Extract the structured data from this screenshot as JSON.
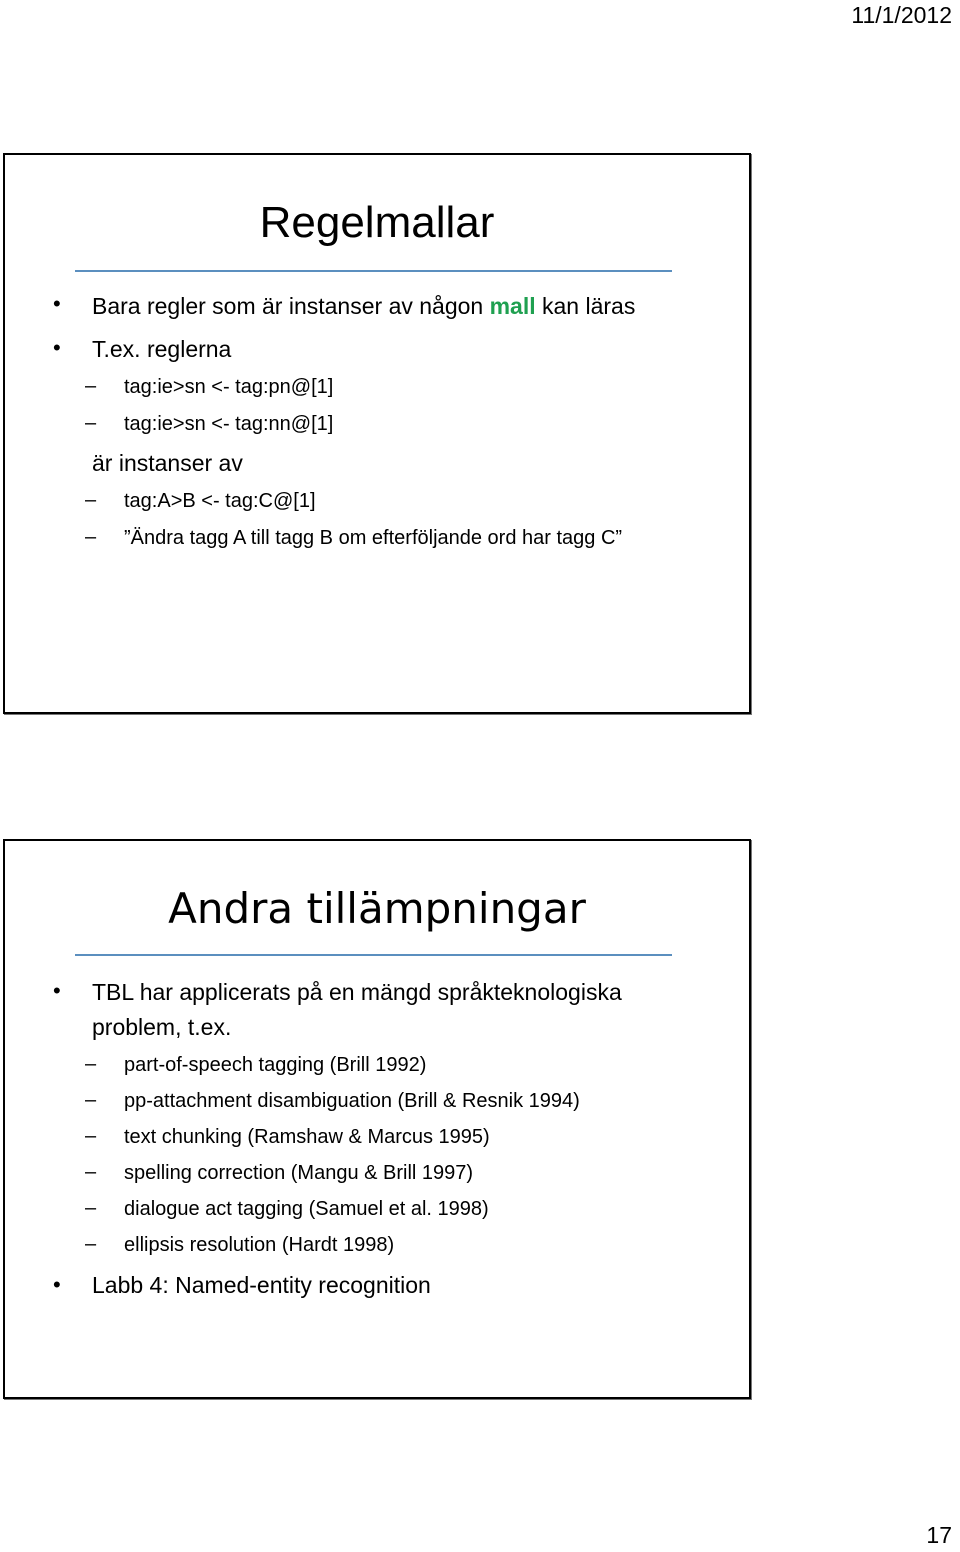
{
  "header": {
    "date": "11/1/2012"
  },
  "footer": {
    "page_number": "17"
  },
  "slide1": {
    "title": "Regelmallar",
    "items": [
      {
        "level": 1,
        "text_before": "Bara regler som är instanser av någon ",
        "highlight": "mall",
        "text_after": " kan läras"
      },
      {
        "level": 1,
        "text": "T.ex. reglerna"
      },
      {
        "level": 2,
        "text": "tag:ie>sn <- tag:pn@[1]"
      },
      {
        "level": 2,
        "text": "tag:ie>sn <- tag:nn@[1]"
      },
      {
        "level": 0,
        "text": "är instanser av"
      },
      {
        "level": 2,
        "text": "tag:A>B <- tag:C@[1]"
      },
      {
        "level": 2,
        "text": "”Ändra tagg A till tagg B om efterföljande ord har tagg C”"
      }
    ],
    "highlight_color": "#1fa050",
    "rule_color": "#5b8fbf"
  },
  "slide2": {
    "title": "Andra tillämpningar",
    "items": [
      {
        "level": 1,
        "text": "TBL har applicerats på en mängd språkteknologiska"
      },
      {
        "level": 1,
        "text": "problem, t.ex."
      },
      {
        "level": 2,
        "text": "part-of-speech tagging (Brill 1992)"
      },
      {
        "level": 2,
        "text": "pp-attachment disambiguation (Brill & Resnik 1994)"
      },
      {
        "level": 2,
        "text": "text chunking (Ramshaw & Marcus 1995)"
      },
      {
        "level": 2,
        "text": "spelling correction (Mangu & Brill 1997)"
      },
      {
        "level": 2,
        "text": "dialogue act tagging (Samuel et al. 1998)"
      },
      {
        "level": 2,
        "text": "ellipsis resolution (Hardt 1998)"
      },
      {
        "level": 1,
        "text": "Labb 4: Named-entity recognition"
      }
    ]
  },
  "symbols": {
    "bullet": "•",
    "dash": "–"
  }
}
